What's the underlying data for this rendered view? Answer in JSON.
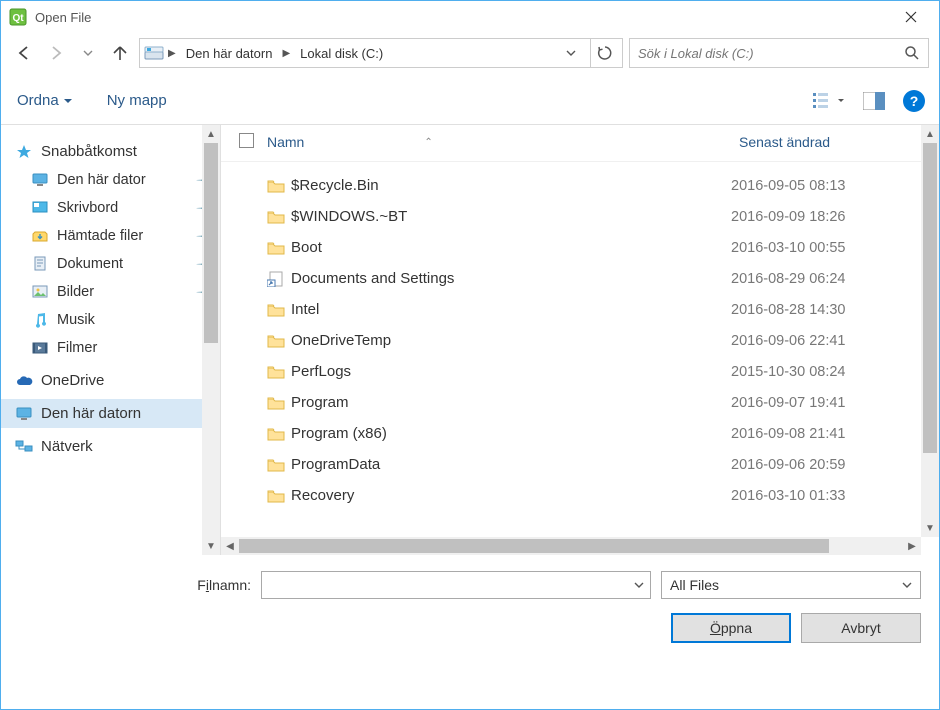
{
  "window": {
    "title": "Open File"
  },
  "breadcrumb": {
    "item1": "Den här datorn",
    "item2": "Lokal disk (C:)"
  },
  "search": {
    "placeholder": "Sök i Lokal disk (C:)"
  },
  "toolbar": {
    "organize": "Ordna",
    "new_folder": "Ny mapp"
  },
  "sidebar": {
    "quick_access": "Snabbåtkomst",
    "this_pc_sub": "Den här dator",
    "desktop": "Skrivbord",
    "downloads": "Hämtade filer",
    "documents": "Dokument",
    "pictures": "Bilder",
    "music": "Musik",
    "videos": "Filmer",
    "onedrive": "OneDrive",
    "this_pc": "Den här datorn",
    "network": "Nätverk"
  },
  "columns": {
    "name": "Namn",
    "modified": "Senast ändrad"
  },
  "files": [
    {
      "name": "$Recycle.Bin",
      "date": "2016-09-05 08:13",
      "type": "folder"
    },
    {
      "name": "$WINDOWS.~BT",
      "date": "2016-09-09 18:26",
      "type": "folder"
    },
    {
      "name": "Boot",
      "date": "2016-03-10 00:55",
      "type": "folder"
    },
    {
      "name": "Documents and Settings",
      "date": "2016-08-29 06:24",
      "type": "shortcut"
    },
    {
      "name": "Intel",
      "date": "2016-08-28 14:30",
      "type": "folder"
    },
    {
      "name": "OneDriveTemp",
      "date": "2016-09-06 22:41",
      "type": "folder"
    },
    {
      "name": "PerfLogs",
      "date": "2015-10-30 08:24",
      "type": "folder"
    },
    {
      "name": "Program",
      "date": "2016-09-07 19:41",
      "type": "folder"
    },
    {
      "name": "Program (x86)",
      "date": "2016-09-08 21:41",
      "type": "folder"
    },
    {
      "name": "ProgramData",
      "date": "2016-09-06 20:59",
      "type": "folder"
    },
    {
      "name": "Recovery",
      "date": "2016-03-10 01:33",
      "type": "folder"
    }
  ],
  "footer": {
    "filename_label": "Filnamn:",
    "filter": "All Files",
    "open": "Öppna",
    "cancel": "Avbryt"
  }
}
